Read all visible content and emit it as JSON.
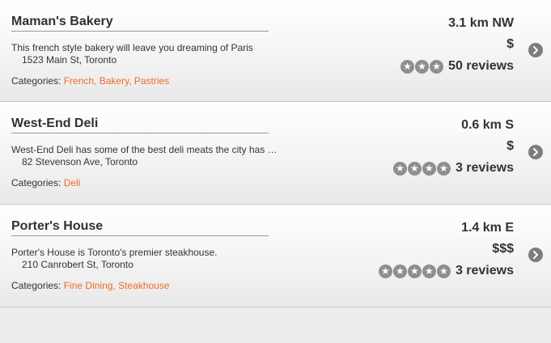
{
  "listings": [
    {
      "name": "Maman's Bakery",
      "description": "This french style bakery will leave you dreaming of Paris",
      "address": "1523 Main St, Toronto",
      "categories_label": "Categories:",
      "categories": "French, Bakery, Pastries",
      "distance": "3.1 km NW",
      "price": "$",
      "stars": 3,
      "reviews": "50 reviews"
    },
    {
      "name": "West-End Deli",
      "description": "West-End Deli has some of the best deli meats the city has to offer",
      "address": "82 Stevenson Ave, Toronto",
      "categories_label": "Categories:",
      "categories": "Deli",
      "distance": "0.6 km S",
      "price": "$",
      "stars": 4,
      "reviews": "3 reviews"
    },
    {
      "name": "Porter's House",
      "description": "Porter's House is Toronto's premier steakhouse.",
      "address": "210 Canrobert St, Toronto",
      "categories_label": "Categories:",
      "categories": "Fine Dining, Steakhouse",
      "distance": "1.4 km E",
      "price": "$$$",
      "stars": 5,
      "reviews": "3 reviews"
    }
  ],
  "icons": {
    "star": "star-icon",
    "chevron": "chevron-right-icon"
  },
  "colors": {
    "category_link": "#f06a2a",
    "star_badge": "#8e8e8e",
    "chevron_badge": "#7d7d7d"
  }
}
